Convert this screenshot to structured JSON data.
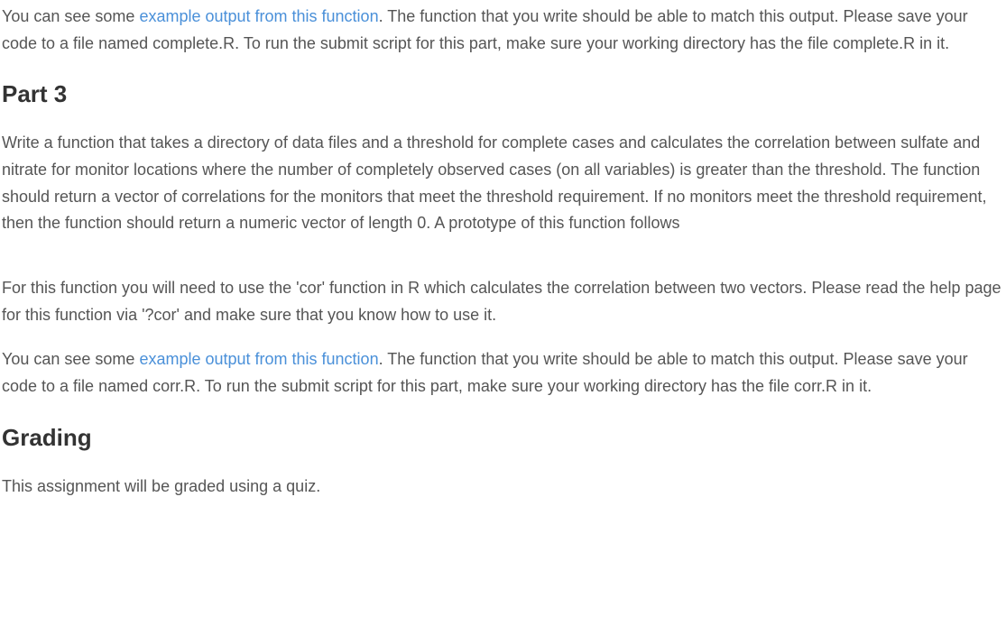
{
  "p1": {
    "prefix": "You can see some ",
    "link": "example output from this function",
    "suffix": ". The function that you write should be able to match this output. Please save your code to a file named complete.R. To run the submit script for this part, make sure your working directory has the file complete.R in it."
  },
  "h_part3": "Part 3",
  "p2": "Write a function that takes a directory of data files and a threshold for complete cases and calculates the correlation between sulfate and nitrate for monitor locations where the number of completely observed cases (on all variables) is greater than the threshold. The function should return a vector of correlations for the monitors that meet the threshold requirement. If no monitors meet the threshold requirement, then the function should return a numeric vector of length 0. A prototype of this function follows",
  "p3": "For this function you will need to use the 'cor' function in R which calculates the correlation between two vectors. Please read the help page for this function via '?cor' and make sure that you know how to use it.",
  "p4": {
    "prefix": "You can see some ",
    "link": "example output from this function",
    "suffix": ". The function that you write should be able to match this output. Please save your code to a file named corr.R. To run the submit script for this part, make sure your working directory has the file corr.R in it."
  },
  "h_grading": "Grading",
  "p5": "This assignment will be graded using a quiz."
}
